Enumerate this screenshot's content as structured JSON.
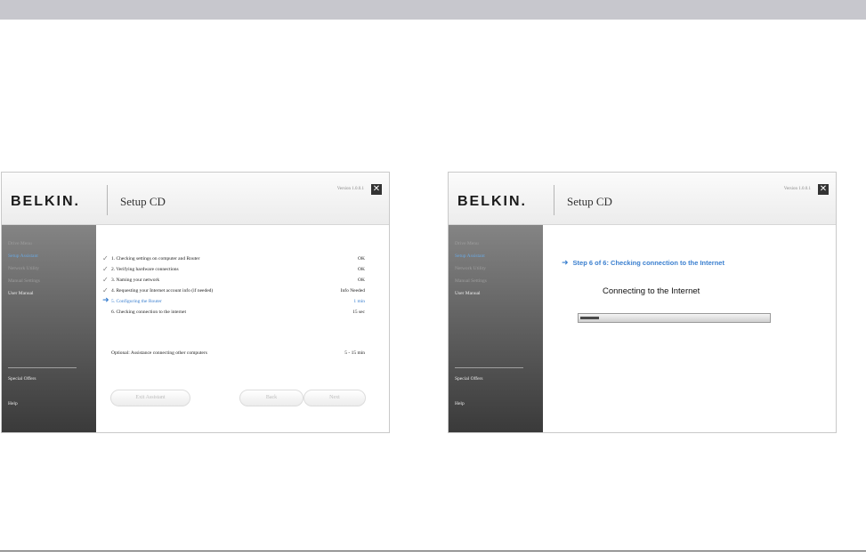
{
  "window_left": {
    "logo": "BELKIN.",
    "title": "Setup CD",
    "version": "Version 1.0.0.1",
    "sidebar": {
      "items": [
        "Drive Menu",
        "Setup Assistant",
        "Network Utility",
        "Manual Settings",
        "User Manual"
      ],
      "bottom_items": [
        "Special Offers",
        "Help"
      ]
    },
    "steps": [
      {
        "label": "1. Checking settings on computer and Router",
        "status": "OK"
      },
      {
        "label": "2. Verifying hardware connections",
        "status": "OK"
      },
      {
        "label": "3. Naming your network",
        "status": "OK"
      },
      {
        "label": "4. Requesting your Internet account info (if needed)",
        "status": "Info Needed"
      },
      {
        "label": "5. Configuring the Router",
        "status": "1 min"
      },
      {
        "label": "6. Checking connection to the internet",
        "status": "15 sec"
      }
    ],
    "optional": {
      "label": "Optional: Assistance connecting other computers",
      "status": "5 - 15 min"
    },
    "buttons": {
      "exit": "Exit Assistant",
      "back": "Back",
      "next": "Next"
    }
  },
  "window_right": {
    "logo": "BELKIN.",
    "title": "Setup CD",
    "version": "Version 1.0.0.1",
    "sidebar": {
      "items": [
        "Drive Menu",
        "Setup Assistant",
        "Network Utility",
        "Manual Settings",
        "User Manual"
      ],
      "bottom_items": [
        "Special Offers",
        "Help"
      ]
    },
    "step_heading": "Step 6 of 6: Checking connection to the Internet",
    "connect_label": "Connecting to the Internet",
    "progress_fraction": 0.1
  },
  "colors": {
    "accent": "#3a7fcf",
    "sidebar_top": "#848484",
    "sidebar_bottom": "#3a3a3a"
  }
}
